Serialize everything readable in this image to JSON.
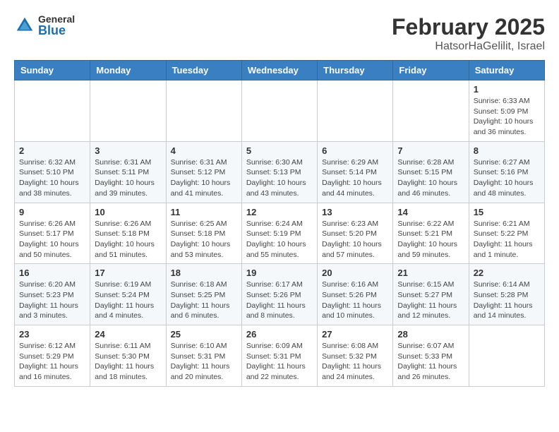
{
  "header": {
    "logo_general": "General",
    "logo_blue": "Blue",
    "month_year": "February 2025",
    "location": "HatsorHaGelilit, Israel"
  },
  "days_of_week": [
    "Sunday",
    "Monday",
    "Tuesday",
    "Wednesday",
    "Thursday",
    "Friday",
    "Saturday"
  ],
  "weeks": [
    [
      {
        "day": "",
        "info": ""
      },
      {
        "day": "",
        "info": ""
      },
      {
        "day": "",
        "info": ""
      },
      {
        "day": "",
        "info": ""
      },
      {
        "day": "",
        "info": ""
      },
      {
        "day": "",
        "info": ""
      },
      {
        "day": "1",
        "info": "Sunrise: 6:33 AM\nSunset: 5:09 PM\nDaylight: 10 hours and 36 minutes."
      }
    ],
    [
      {
        "day": "2",
        "info": "Sunrise: 6:32 AM\nSunset: 5:10 PM\nDaylight: 10 hours and 38 minutes."
      },
      {
        "day": "3",
        "info": "Sunrise: 6:31 AM\nSunset: 5:11 PM\nDaylight: 10 hours and 39 minutes."
      },
      {
        "day": "4",
        "info": "Sunrise: 6:31 AM\nSunset: 5:12 PM\nDaylight: 10 hours and 41 minutes."
      },
      {
        "day": "5",
        "info": "Sunrise: 6:30 AM\nSunset: 5:13 PM\nDaylight: 10 hours and 43 minutes."
      },
      {
        "day": "6",
        "info": "Sunrise: 6:29 AM\nSunset: 5:14 PM\nDaylight: 10 hours and 44 minutes."
      },
      {
        "day": "7",
        "info": "Sunrise: 6:28 AM\nSunset: 5:15 PM\nDaylight: 10 hours and 46 minutes."
      },
      {
        "day": "8",
        "info": "Sunrise: 6:27 AM\nSunset: 5:16 PM\nDaylight: 10 hours and 48 minutes."
      }
    ],
    [
      {
        "day": "9",
        "info": "Sunrise: 6:26 AM\nSunset: 5:17 PM\nDaylight: 10 hours and 50 minutes."
      },
      {
        "day": "10",
        "info": "Sunrise: 6:26 AM\nSunset: 5:18 PM\nDaylight: 10 hours and 51 minutes."
      },
      {
        "day": "11",
        "info": "Sunrise: 6:25 AM\nSunset: 5:18 PM\nDaylight: 10 hours and 53 minutes."
      },
      {
        "day": "12",
        "info": "Sunrise: 6:24 AM\nSunset: 5:19 PM\nDaylight: 10 hours and 55 minutes."
      },
      {
        "day": "13",
        "info": "Sunrise: 6:23 AM\nSunset: 5:20 PM\nDaylight: 10 hours and 57 minutes."
      },
      {
        "day": "14",
        "info": "Sunrise: 6:22 AM\nSunset: 5:21 PM\nDaylight: 10 hours and 59 minutes."
      },
      {
        "day": "15",
        "info": "Sunrise: 6:21 AM\nSunset: 5:22 PM\nDaylight: 11 hours and 1 minute."
      }
    ],
    [
      {
        "day": "16",
        "info": "Sunrise: 6:20 AM\nSunset: 5:23 PM\nDaylight: 11 hours and 3 minutes."
      },
      {
        "day": "17",
        "info": "Sunrise: 6:19 AM\nSunset: 5:24 PM\nDaylight: 11 hours and 4 minutes."
      },
      {
        "day": "18",
        "info": "Sunrise: 6:18 AM\nSunset: 5:25 PM\nDaylight: 11 hours and 6 minutes."
      },
      {
        "day": "19",
        "info": "Sunrise: 6:17 AM\nSunset: 5:26 PM\nDaylight: 11 hours and 8 minutes."
      },
      {
        "day": "20",
        "info": "Sunrise: 6:16 AM\nSunset: 5:26 PM\nDaylight: 11 hours and 10 minutes."
      },
      {
        "day": "21",
        "info": "Sunrise: 6:15 AM\nSunset: 5:27 PM\nDaylight: 11 hours and 12 minutes."
      },
      {
        "day": "22",
        "info": "Sunrise: 6:14 AM\nSunset: 5:28 PM\nDaylight: 11 hours and 14 minutes."
      }
    ],
    [
      {
        "day": "23",
        "info": "Sunrise: 6:12 AM\nSunset: 5:29 PM\nDaylight: 11 hours and 16 minutes."
      },
      {
        "day": "24",
        "info": "Sunrise: 6:11 AM\nSunset: 5:30 PM\nDaylight: 11 hours and 18 minutes."
      },
      {
        "day": "25",
        "info": "Sunrise: 6:10 AM\nSunset: 5:31 PM\nDaylight: 11 hours and 20 minutes."
      },
      {
        "day": "26",
        "info": "Sunrise: 6:09 AM\nSunset: 5:31 PM\nDaylight: 11 hours and 22 minutes."
      },
      {
        "day": "27",
        "info": "Sunrise: 6:08 AM\nSunset: 5:32 PM\nDaylight: 11 hours and 24 minutes."
      },
      {
        "day": "28",
        "info": "Sunrise: 6:07 AM\nSunset: 5:33 PM\nDaylight: 11 hours and 26 minutes."
      },
      {
        "day": "",
        "info": ""
      }
    ]
  ]
}
